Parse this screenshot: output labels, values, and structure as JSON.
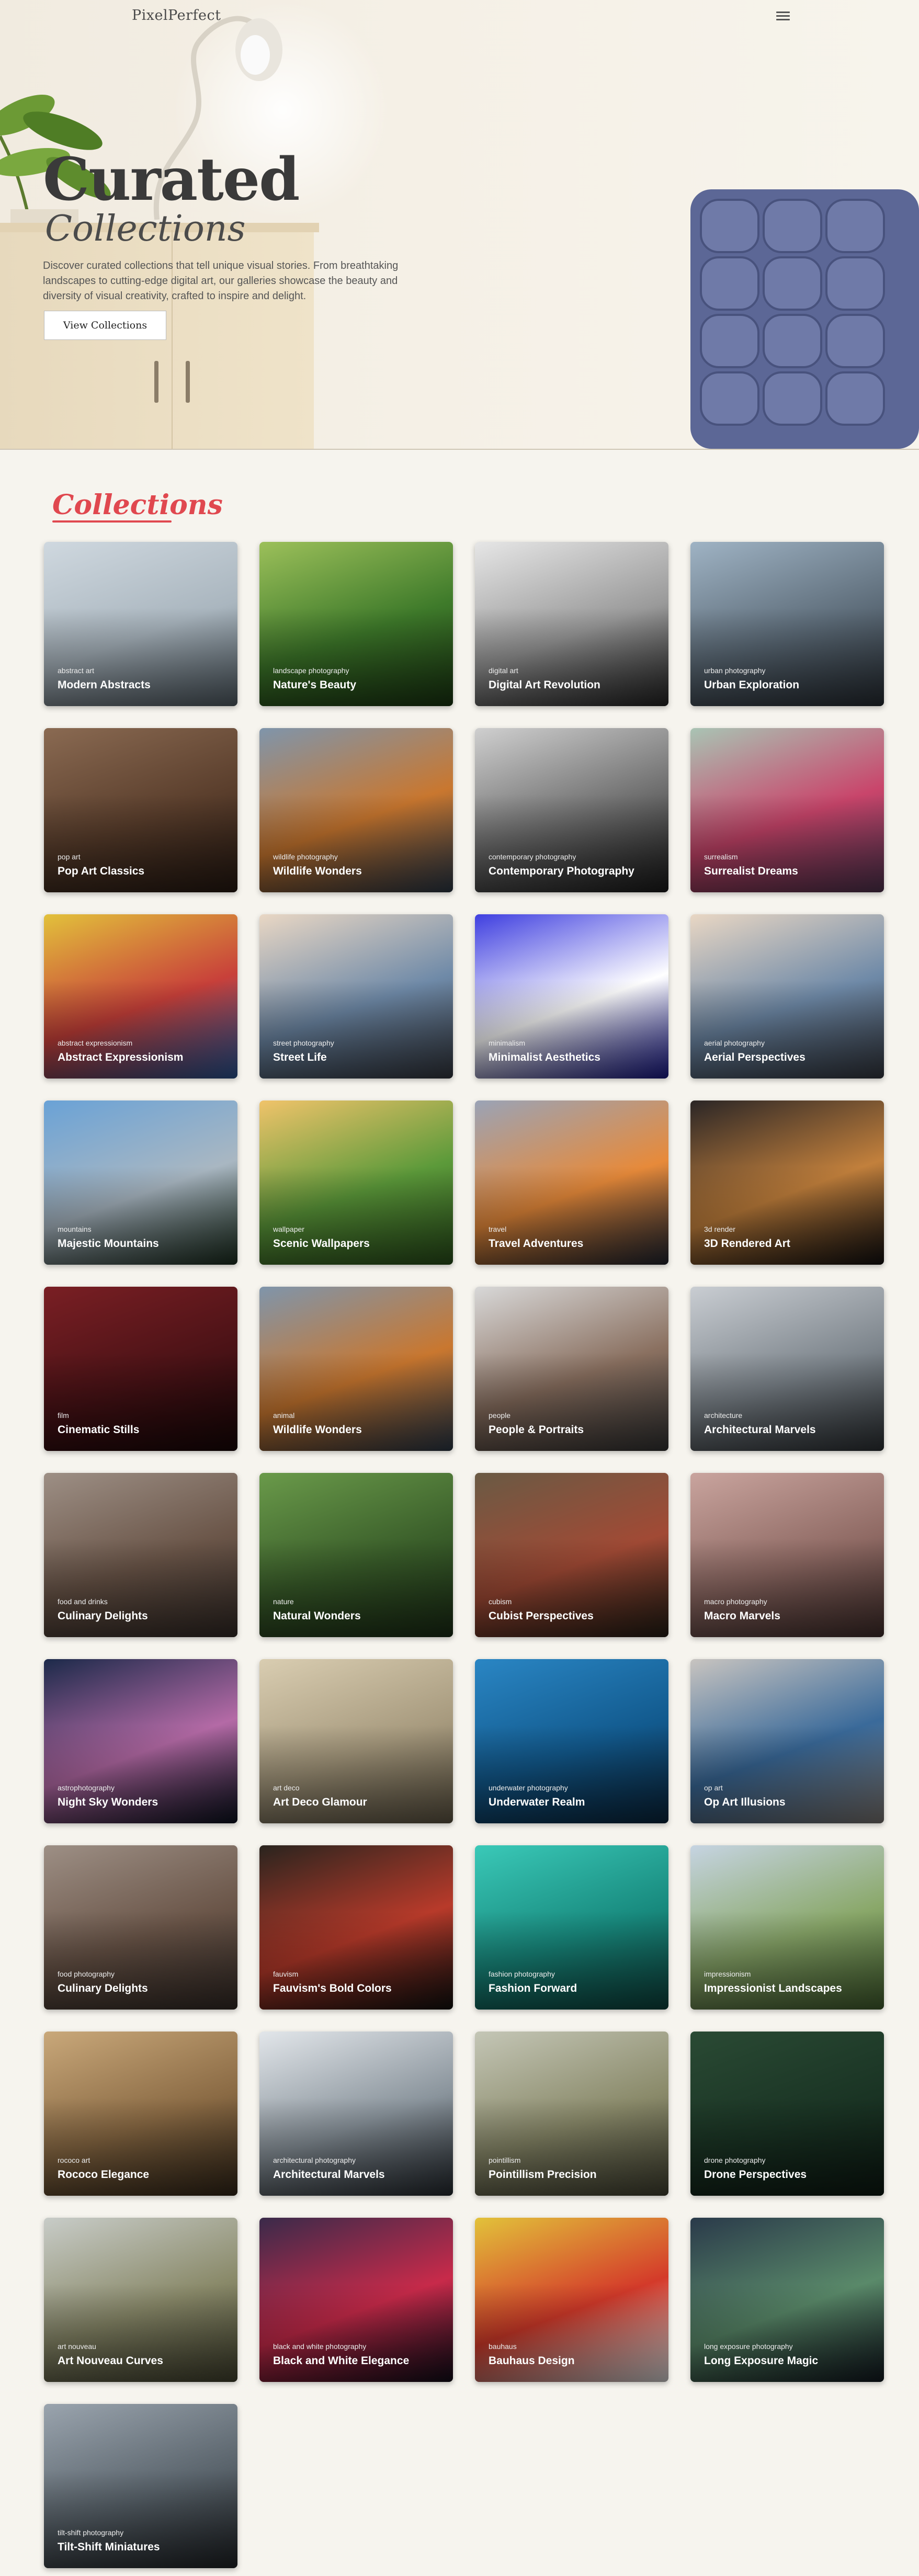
{
  "header": {
    "logo": "PixelPerfect",
    "menu_icon": "hamburger-menu-icon"
  },
  "hero": {
    "title_line1": "Curated",
    "title_line2": "Collections",
    "description": "Discover curated collections that tell unique visual stories. From breathtaking landscapes to cutting-edge digital art, our galleries showcase the beauty and diversity of visual creativity, crafted to inspire and delight.",
    "button_label": "View Collections"
  },
  "collections": {
    "heading": "Collections",
    "items": [
      {
        "category": "abstract art",
        "title": "Modern Abstracts",
        "colors": [
          "#cfd8df",
          "#aab6bf",
          "#5d6a73"
        ]
      },
      {
        "category": "landscape photography",
        "title": "Nature's Beauty",
        "colors": [
          "#9cc05a",
          "#3e7a2a",
          "#1d3d14"
        ]
      },
      {
        "category": "digital art",
        "title": "Digital Art Revolution",
        "colors": [
          "#e6e6e6",
          "#9a9a9a",
          "#2a2a2a"
        ]
      },
      {
        "category": "urban photography",
        "title": "Urban Exploration",
        "colors": [
          "#9fb3c4",
          "#5e6d7a",
          "#2c333a"
        ]
      },
      {
        "category": "pop art",
        "title": "Pop Art Classics",
        "colors": [
          "#8a6a52",
          "#5a3e2c",
          "#2b1c14"
        ]
      },
      {
        "category": "wildlife photography",
        "title": "Wildlife Wonders",
        "colors": [
          "#7f95ab",
          "#c9772f",
          "#324050"
        ]
      },
      {
        "category": "contemporary photography",
        "title": "Contemporary Photography",
        "colors": [
          "#cfcfcf",
          "#6e6e6e",
          "#1e1e1e"
        ]
      },
      {
        "category": "surrealism",
        "title": "Surrealist Dreams",
        "colors": [
          "#a9c4b4",
          "#c9456b",
          "#5c3a5a"
        ]
      },
      {
        "category": "abstract expressionism",
        "title": "Abstract Expressionism",
        "colors": [
          "#e2c13b",
          "#c8403a",
          "#2e5fa8"
        ]
      },
      {
        "category": "street photography",
        "title": "Street Life",
        "colors": [
          "#e9d7c4",
          "#6f8aa8",
          "#3a3f48"
        ]
      },
      {
        "category": "minimalism",
        "title": "Minimalist Aesthetics",
        "colors": [
          "#3f3fe0",
          "#ffffff",
          "#1c1c9a"
        ]
      },
      {
        "category": "aerial photography",
        "title": "Aerial Perspectives",
        "colors": [
          "#e9d7c4",
          "#6f8aa8",
          "#3a3f48"
        ]
      },
      {
        "category": "mountains",
        "title": "Majestic Mountains",
        "colors": [
          "#6aa2d6",
          "#a9b7c2",
          "#1f3424"
        ]
      },
      {
        "category": "wallpaper",
        "title": "Scenic Wallpapers",
        "colors": [
          "#f0c36a",
          "#5c9a3a",
          "#2f5a1e"
        ]
      },
      {
        "category": "travel",
        "title": "Travel Adventures",
        "colors": [
          "#9aa3b6",
          "#e78a3a",
          "#262a36"
        ]
      },
      {
        "category": "3d render",
        "title": "3D Rendered Art",
        "colors": [
          "#2b2626",
          "#c2803c",
          "#151212"
        ]
      },
      {
        "category": "film",
        "title": "Cinematic Stills",
        "colors": [
          "#7a1f24",
          "#4a1216",
          "#1b0708"
        ]
      },
      {
        "category": "animal",
        "title": "Wildlife Wonders",
        "colors": [
          "#7f95ab",
          "#c9772f",
          "#324050"
        ]
      },
      {
        "category": "people",
        "title": "People & Portraits",
        "colors": [
          "#d8d8d8",
          "#8a7060",
          "#3a3a3a"
        ]
      },
      {
        "category": "architecture",
        "title": "Architectural Marvels",
        "colors": [
          "#c9cdd2",
          "#7d858c",
          "#33383c"
        ]
      },
      {
        "category": "food and drinks",
        "title": "Culinary Delights",
        "colors": [
          "#9d8f85",
          "#6a5548",
          "#3a302b"
        ]
      },
      {
        "category": "nature",
        "title": "Natural Wonders",
        "colors": [
          "#6a9a4a",
          "#3a5e2a",
          "#1e3318"
        ]
      },
      {
        "category": "cubism",
        "title": "Cubist Perspectives",
        "colors": [
          "#6a5a44",
          "#a14a35",
          "#2a2218"
        ]
      },
      {
        "category": "macro photography",
        "title": "Macro Marvels",
        "colors": [
          "#c9a49e",
          "#8f6a64",
          "#4a3431"
        ]
      },
      {
        "category": "astrophotography",
        "title": "Night Sky Wonders",
        "colors": [
          "#1c2a4a",
          "#b46aa6",
          "#0e1424"
        ]
      },
      {
        "category": "art deco",
        "title": "Art Deco Glamour",
        "colors": [
          "#d9cdb1",
          "#a79a7e",
          "#6a604c"
        ]
      },
      {
        "category": "underwater photography",
        "title": "Underwater Realm",
        "colors": [
          "#2a86c4",
          "#125a8e",
          "#0a2a44"
        ]
      },
      {
        "category": "op art",
        "title": "Op Art Illusions",
        "colors": [
          "#c8c4c0",
          "#3a6a9a",
          "#8a8480"
        ]
      },
      {
        "category": "food photography",
        "title": "Culinary Delights",
        "colors": [
          "#9d8f85",
          "#6a5548",
          "#3a302b"
        ]
      },
      {
        "category": "fauvism",
        "title": "Fauvism's Bold Colors",
        "colors": [
          "#2a241e",
          "#b83a2a",
          "#141210"
        ]
      },
      {
        "category": "fashion photography",
        "title": "Fashion Forward",
        "colors": [
          "#3ac9b8",
          "#188a7e",
          "#0e4a44"
        ]
      },
      {
        "category": "impressionism",
        "title": "Impressionist Landscapes",
        "colors": [
          "#c6d4e2",
          "#8aa86a",
          "#4a6a34"
        ]
      },
      {
        "category": "rococo art",
        "title": "Rococo Elegance",
        "colors": [
          "#c9a87a",
          "#8a6a44",
          "#3a2c1c"
        ]
      },
      {
        "category": "architectural photography",
        "title": "Architectural Marvels",
        "colors": [
          "#e2e6ea",
          "#8a949c",
          "#2a3036"
        ]
      },
      {
        "category": "pointillism",
        "title": "Pointillism Precision",
        "colors": [
          "#c4c6b6",
          "#8a8a6a",
          "#4a4a38"
        ]
      },
      {
        "category": "drone photography",
        "title": "Drone Perspectives",
        "colors": [
          "#2a4a34",
          "#1a3424",
          "#0e1c14"
        ]
      },
      {
        "category": "art nouveau",
        "title": "Art Nouveau Curves",
        "colors": [
          "#c8ccc8",
          "#8a8a6a",
          "#4a4a34"
        ]
      },
      {
        "category": "black and white photography",
        "title": "Black and White Elegance",
        "colors": [
          "#3a2a4a",
          "#c82a4a",
          "#140e1c"
        ]
      },
      {
        "category": "bauhaus",
        "title": "Bauhaus Design",
        "colors": [
          "#e2c23a",
          "#d43a2a",
          "#f2f2f2"
        ]
      },
      {
        "category": "long exposure photography",
        "title": "Long Exposure Magic",
        "colors": [
          "#2a3a4a",
          "#5a8a6a",
          "#141c24"
        ]
      },
      {
        "category": "tilt-shift photography",
        "title": "Tilt-Shift Miniatures",
        "colors": [
          "#9aa4ae",
          "#5a646c",
          "#24282c"
        ]
      }
    ]
  }
}
